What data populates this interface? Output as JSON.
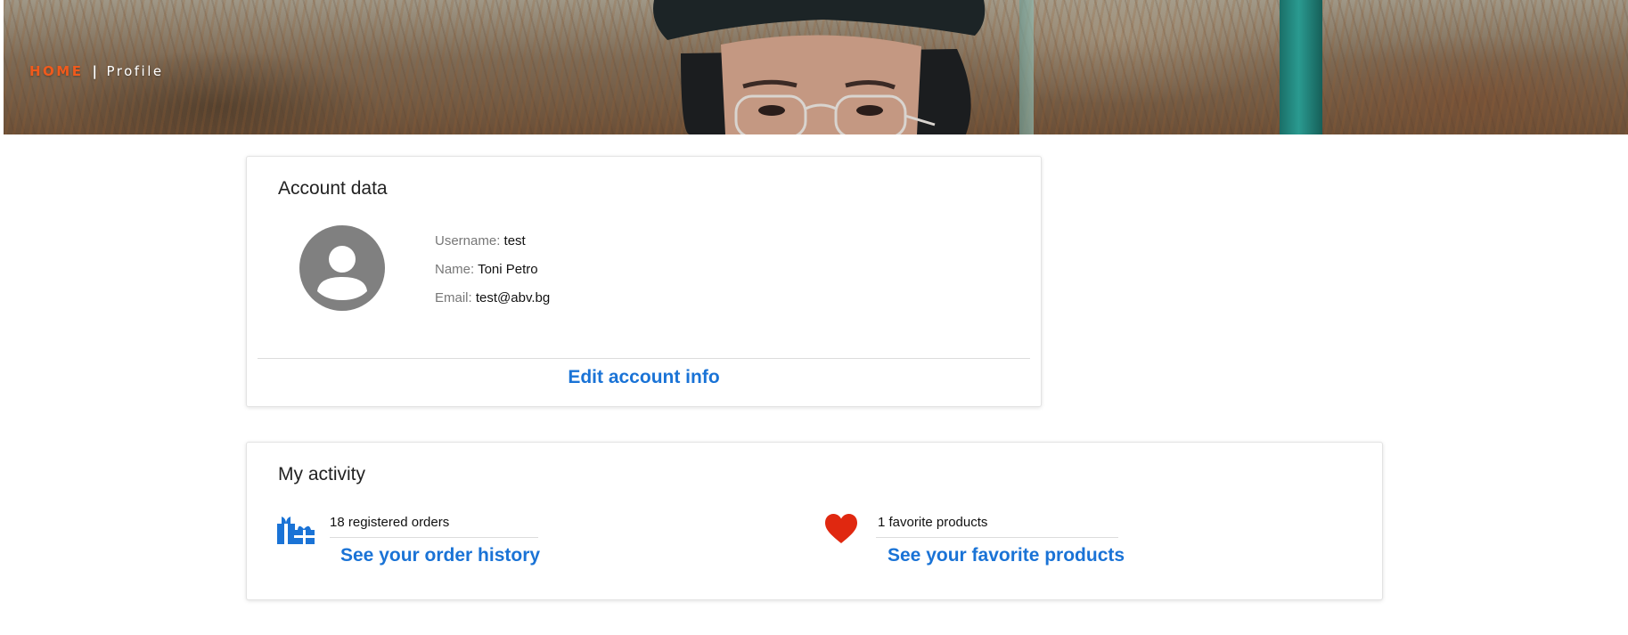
{
  "breadcrumb": {
    "home_label": "HOME",
    "separator": "|",
    "current_label": "Profile"
  },
  "account": {
    "title": "Account data",
    "username_label": "Username:",
    "username_value": "test",
    "name_label": "Name:",
    "name_value": "Toni Petro",
    "email_label": "Email:",
    "email_value": "test@abv.bg",
    "edit_link": "Edit account info",
    "avatar_icon": "user-avatar-icon"
  },
  "activity": {
    "title": "My activity",
    "orders": {
      "count_text": "18 registered orders",
      "link_text": "See your order history",
      "icon": "gifts-icon"
    },
    "favorites": {
      "count_text": "1 favorite products",
      "link_text": "See your favorite products",
      "icon": "heart-icon"
    }
  },
  "colors": {
    "accent_orange": "#f05a1c",
    "link_blue": "#1a73d6",
    "heart_red": "#e02810",
    "avatar_gray": "#808080"
  }
}
